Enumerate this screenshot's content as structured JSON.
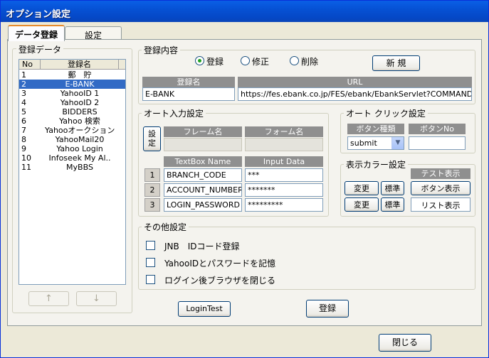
{
  "window": {
    "title": "オプション設定"
  },
  "tabs": [
    {
      "label": "データ登録",
      "active": true
    },
    {
      "label": "設定",
      "active": false
    }
  ],
  "data_list": {
    "group_label": "登録データ",
    "columns": [
      "No",
      "登録名"
    ],
    "rows": [
      {
        "no": "1",
        "name": "郵　貯"
      },
      {
        "no": "2",
        "name": "E-BANK",
        "selected": true
      },
      {
        "no": "3",
        "name": "YahooID 1"
      },
      {
        "no": "4",
        "name": "YahooID 2"
      },
      {
        "no": "5",
        "name": "BIDDERS"
      },
      {
        "no": "6",
        "name": "Yahoo 検索"
      },
      {
        "no": "7",
        "name": "Yahooオークション"
      },
      {
        "no": "8",
        "name": "YahooMail20"
      },
      {
        "no": "9",
        "name": "Yahoo Login"
      },
      {
        "no": "10",
        "name": "Infoseek My Al.."
      },
      {
        "no": "11",
        "name": "MyBBS"
      }
    ],
    "up_label": "↑",
    "down_label": "↓"
  },
  "registration": {
    "group_label": "登録内容",
    "modes": [
      {
        "label": "登録",
        "selected": true
      },
      {
        "label": "修正",
        "selected": false
      },
      {
        "label": "削除",
        "selected": false
      }
    ],
    "new_button": "新 規",
    "name_header": "登録名",
    "url_header": "URL",
    "name_value": "E-BANK",
    "url_value": "https://fes.ebank.co.jp/FES/ebank/EbankServlet?COMMAND=L("
  },
  "auto_input": {
    "group_label": "オート入力設定",
    "set_button": "設\n定",
    "frame_header": "フレーム名",
    "form_header": "フォーム名",
    "frame_value": "",
    "form_value": "",
    "textbox_header": "TextBox Name",
    "input_header": "Input Data",
    "rows": [
      {
        "num": "1",
        "name": "BRANCH_CODE",
        "data": "***"
      },
      {
        "num": "2",
        "name": "ACCOUNT_NUMBER",
        "data": "*******"
      },
      {
        "num": "3",
        "name": "LOGIN_PASSWORD",
        "data": "*********"
      }
    ]
  },
  "auto_click": {
    "group_label": "オート クリック設定",
    "type_header": "ボタン種類",
    "no_header": "ボタンNo",
    "type_value": "submit",
    "no_value": ""
  },
  "color_settings": {
    "group_label": "表示カラー設定",
    "test_header": "テスト表示",
    "change_label": "変更",
    "default_label": "標準",
    "button_preview": "ボタン表示",
    "list_preview": "リスト表示"
  },
  "other_settings": {
    "group_label": "その他設定",
    "options": [
      {
        "label": "JNB　IDコード登録",
        "checked": false
      },
      {
        "label": "YahooIDとパスワードを記憶",
        "checked": false
      },
      {
        "label": "ログイン後ブラウザを閉じる",
        "checked": false
      }
    ]
  },
  "footer": {
    "login_test": "LoginTest",
    "register": "登録",
    "close": "閉じる"
  }
}
